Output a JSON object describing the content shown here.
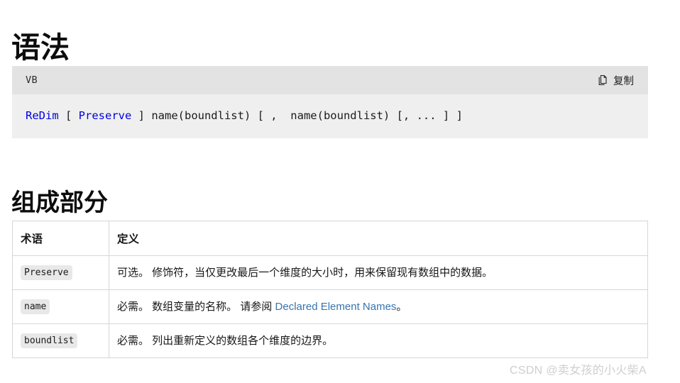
{
  "headings": {
    "syntax": "语法",
    "parts": "组成部分"
  },
  "code_block": {
    "language_label": "VB",
    "copy_label": "复制",
    "copy_icon": "copy-icon",
    "segments": [
      {
        "text": "ReDim",
        "kind": "keyword"
      },
      {
        "text": " [ ",
        "kind": "plain"
      },
      {
        "text": "Preserve",
        "kind": "keyword"
      },
      {
        "text": " ] name(boundlist) [ ,  name(boundlist) [, ... ] ]",
        "kind": "plain"
      }
    ],
    "full_text": "ReDim [ Preserve ] name(boundlist) [ ,  name(boundlist) [, ... ] ]",
    "header_bg": "#e3e3e3",
    "body_bg": "#efefef",
    "keyword_color": "#0000e0"
  },
  "table": {
    "headers": [
      "术语",
      "定义"
    ],
    "rows": [
      {
        "term": "Preserve",
        "definition": "可选。 修饰符，当仅更改最后一个维度的大小时，用来保留现有数组中的数据。",
        "def_prefix": "可选。 修饰符，当仅更改最后一个维度的大小时，用来保留现有数组中的数据。",
        "link_text": "",
        "def_suffix": ""
      },
      {
        "term": "name",
        "definition": "必需。 数组变量的名称。 请参阅 Declared Element Names。",
        "def_prefix": "必需。 数组变量的名称。 请参阅 ",
        "link_text": "Declared Element Names",
        "def_suffix": "。"
      },
      {
        "term": "boundlist",
        "definition": "必需。 列出重新定义的数组各个维度的边界。",
        "def_prefix": "必需。 列出重新定义的数组各个维度的边界。",
        "link_text": "",
        "def_suffix": ""
      }
    ],
    "link_color": "#3774b0",
    "chip_bg": "#e8e8e8",
    "border_color": "#d6d6d6"
  },
  "watermark": {
    "text": "CSDN @卖女孩的小火柴A",
    "color": "#cfcfcf"
  }
}
